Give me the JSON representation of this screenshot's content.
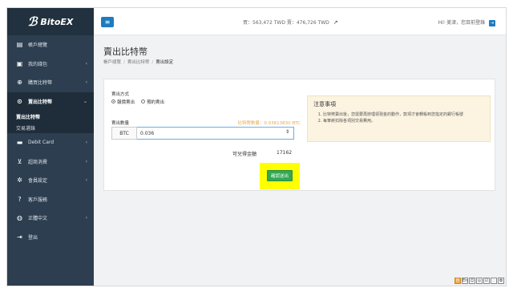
{
  "brand": {
    "mark": "ℬ",
    "name": "BitoEX"
  },
  "sidebar": {
    "items": [
      {
        "label": "帳戶總覽",
        "icon": "dashboard-icon",
        "glyph": "▤",
        "arrow": ""
      },
      {
        "label": "我的錢包",
        "icon": "wallet-icon",
        "glyph": "▣",
        "arrow": "‹"
      },
      {
        "label": "購買比特幣",
        "icon": "download-circle-icon",
        "glyph": "⊕",
        "arrow": "‹"
      },
      {
        "label": "賣出比特幣",
        "icon": "upload-circle-icon",
        "glyph": "⊙",
        "arrow": "⌄"
      },
      {
        "label": "Debit Card",
        "icon": "credit-card-icon",
        "glyph": "▬",
        "arrow": "‹"
      },
      {
        "label": "超商消費",
        "icon": "cart-icon",
        "glyph": "⊻",
        "arrow": "‹"
      },
      {
        "label": "會員設定",
        "icon": "gears-icon",
        "glyph": "✲",
        "arrow": "‹"
      },
      {
        "label": "客戶服務",
        "icon": "question-circle-icon",
        "glyph": "?",
        "arrow": ""
      },
      {
        "label": "正體中文",
        "icon": "globe-icon",
        "glyph": "◍",
        "arrow": "‹"
      },
      {
        "label": "登出",
        "icon": "sign-out-icon",
        "glyph": "⇥",
        "arrow": ""
      }
    ],
    "sub_items": [
      "賣出比特幣",
      "交易選錄"
    ]
  },
  "topbar": {
    "menu_glyph": "≡",
    "rate_text": "買：563,472 TWD    賣：476,726 TWD",
    "rate_chart_glyph": "↗",
    "user_text": "Hi! 美津，您目前登錄",
    "logout_glyph": "⇥"
  },
  "page": {
    "title": "賣出比特幣",
    "breadcrumb": [
      "帳戶總覽",
      "賣出比特幣",
      "賣出設定"
    ]
  },
  "form": {
    "method_label": "賣出方式",
    "options": [
      "報價賣出",
      "預約賣出"
    ],
    "selected_option": 0,
    "amount_label": "賣出數量",
    "max_note": "比特幣數量：0.03613830 BTC",
    "unit": "BTC",
    "amount_value": "0.036",
    "available_label": "可兌得金額",
    "available_value": "17162",
    "confirm_label": "確認送出"
  },
  "notice": {
    "title": "注意事項",
    "items": [
      "比特幣賣出後，您需要再辦理領現金的動作，款項才會轉帳到您指定的銀行帳號",
      "每筆將扣除各項別交易費用。"
    ]
  },
  "tools": [
    "自",
    "En",
    "☺",
    "◎",
    "☑",
    "∴",
    "✿"
  ],
  "colors": {
    "sidebar": "#2c3e50",
    "accent": "#1f7bc1",
    "confirm": "#32a852",
    "highlight": "#ffff00",
    "notice_bg": "#fcf4e1"
  }
}
